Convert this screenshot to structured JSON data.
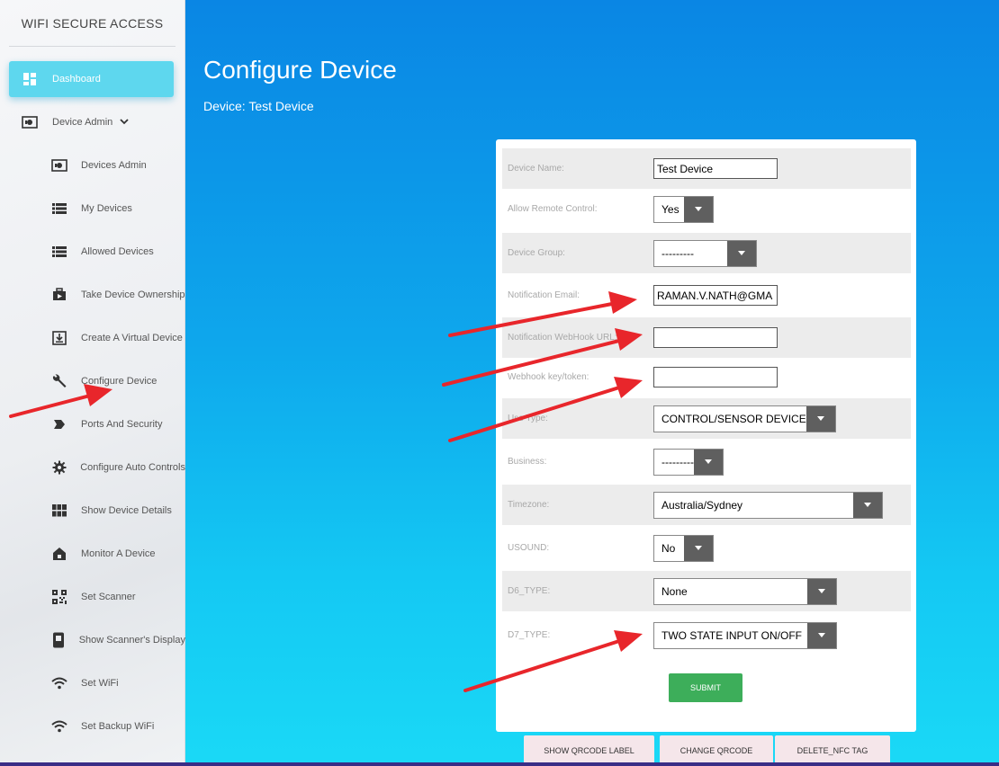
{
  "sidebar": {
    "brand": "WIFI SECURE ACCESS",
    "items": [
      {
        "label": "Dashboard",
        "icon": "dashboard-icon"
      },
      {
        "label": "Device Admin",
        "icon": "device-admin-icon"
      },
      {
        "label": "Devices Admin",
        "icon": "device-admin-icon"
      },
      {
        "label": "My Devices",
        "icon": "list-icon"
      },
      {
        "label": "Allowed Devices",
        "icon": "list-icon"
      },
      {
        "label": "Take Device Ownership",
        "icon": "briefcase-icon"
      },
      {
        "label": "Create A Virtual Device",
        "icon": "download-box-icon"
      },
      {
        "label": "Configure Device",
        "icon": "wrench-icon"
      },
      {
        "label": "Ports And Security",
        "icon": "label-arrow-icon"
      },
      {
        "label": "Configure Auto Controls",
        "icon": "gear-icon"
      },
      {
        "label": "Show Device Details",
        "icon": "grid-icon"
      },
      {
        "label": "Monitor A Device",
        "icon": "home-icon"
      },
      {
        "label": "Set Scanner",
        "icon": "qrcode-icon"
      },
      {
        "label": "Show Scanner's Display",
        "icon": "phone-icon"
      },
      {
        "label": "Set WiFi",
        "icon": "wifi-icon"
      },
      {
        "label": "Set Backup WiFi",
        "icon": "wifi-icon"
      }
    ]
  },
  "header": {
    "title": "Configure Device",
    "subtitle": "Device: Test Device"
  },
  "form": {
    "fields": [
      {
        "label": "Device Name:",
        "value": "Test Device"
      },
      {
        "label": "Allow Remote Control:",
        "value": "Yes"
      },
      {
        "label": "Device Group:",
        "value": "---------"
      },
      {
        "label": "Notification Email:",
        "value": "RAMAN.V.NATH@GMA"
      },
      {
        "label": "Notification WebHook URL:",
        "value": ""
      },
      {
        "label": "Webhook key/token:",
        "value": ""
      },
      {
        "label": "Use Type:",
        "value": "CONTROL/SENSOR DEVICE"
      },
      {
        "label": "Business:",
        "value": "---------"
      },
      {
        "label": "Timezone:",
        "value": "Australia/Sydney"
      },
      {
        "label": "USOUND:",
        "value": "No"
      },
      {
        "label": "D6_TYPE:",
        "value": "None"
      },
      {
        "label": "D7_TYPE:",
        "value": "TWO STATE INPUT ON/OFF"
      }
    ],
    "submit": "SUBMIT"
  },
  "buttons": {
    "show_qrcode": "SHOW QRCODE LABEL",
    "change_qrcode": "CHANGE QRCODE",
    "delete_nfc": "DELETE_NFC TAG"
  },
  "colors": {
    "accent": "#5ed7ee",
    "submit": "#3dae5a",
    "annotation_arrow": "#e8262b"
  }
}
